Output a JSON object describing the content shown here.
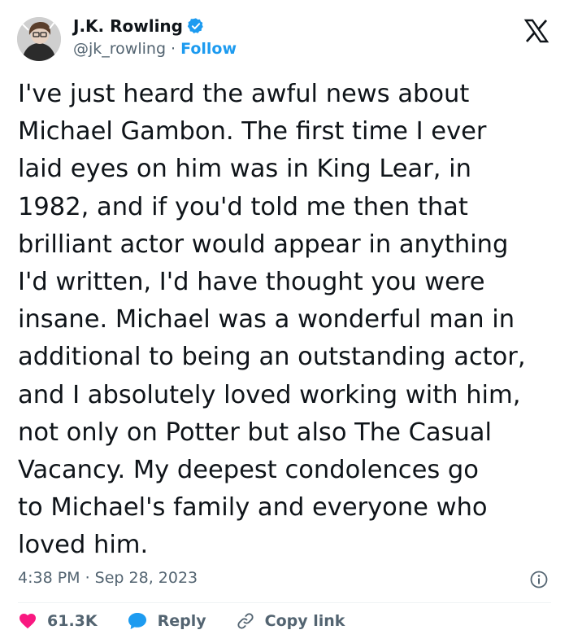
{
  "author": {
    "name": "J.K. Rowling",
    "handle": "@jk_rowling",
    "separator": " · ",
    "follow_label": "Follow"
  },
  "tweet": {
    "text": "I've just heard the awful news about\nMichael Gambon. The first time I ever\nlaid eyes on him was in King Lear, in\n1982, and if you'd told me then that\nbrilliant actor would appear in anything\nI'd written, I'd have thought you were\ninsane. Michael was a wonderful man in\nadditional to being an outstanding actor,\nand I absolutely loved working with him,\nnot only on Potter but also The Casual\nVacancy. My deepest condolences go\nto Michael's family and everyone who\nloved him.",
    "timestamp": "4:38 PM · Sep 28, 2023"
  },
  "actions": {
    "likes": "61.3K",
    "reply_label": "Reply",
    "copy_label": "Copy link"
  },
  "colors": {
    "heart": "#f91880",
    "reply": "#1d9bf0",
    "follow": "#1d9bf0",
    "verified": "#1d9bf0",
    "secondary_text": "#536471"
  },
  "icons": [
    "avatar",
    "verified-badge-icon",
    "x-logo-icon",
    "info-icon",
    "heart-icon",
    "reply-bubble-icon",
    "link-icon"
  ]
}
